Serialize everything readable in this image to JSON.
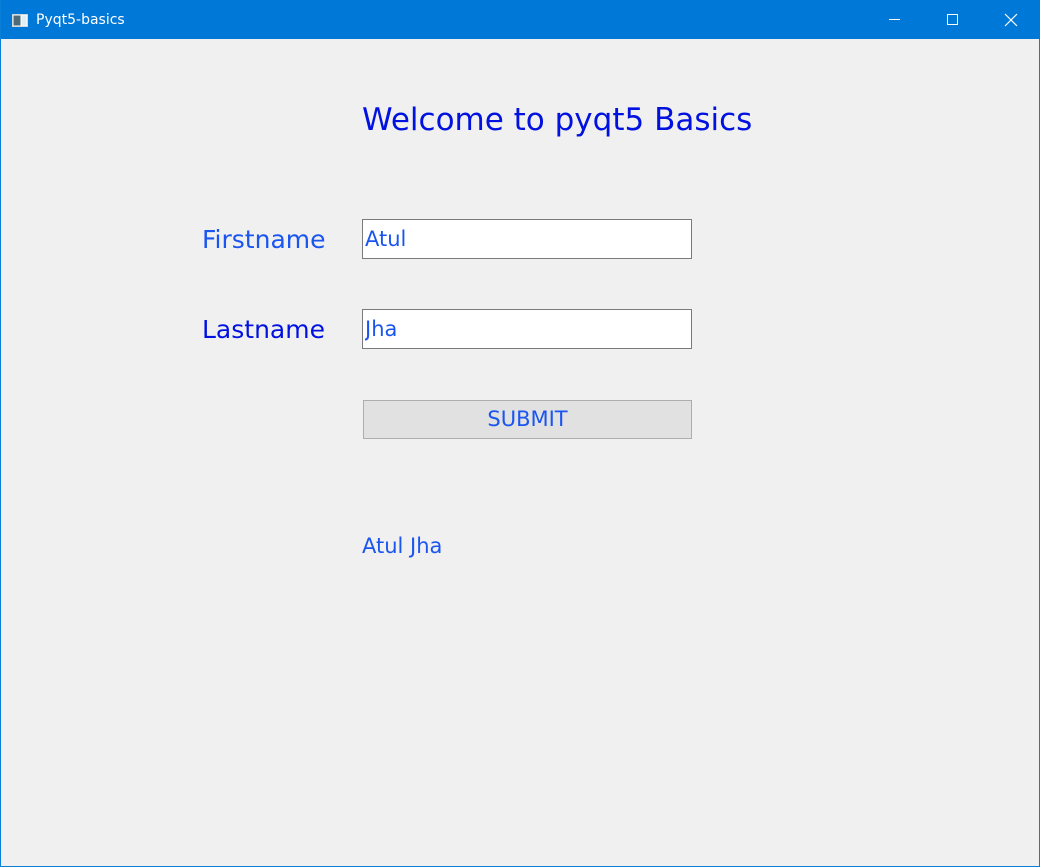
{
  "window": {
    "title": "Pyqt5-basics"
  },
  "form": {
    "heading": "Welcome to pyqt5 Basics",
    "firstname_label": "Firstname",
    "firstname_value": "Atul",
    "lastname_label": "Lastname",
    "lastname_value": "Jha",
    "submit_label": "SUBMIT",
    "result_text": "Atul Jha"
  },
  "icons": {
    "app": "app-window-icon",
    "minimize": "minimize-icon",
    "maximize": "maximize-icon",
    "close": "close-icon"
  },
  "colors": {
    "titlebar": "#0078d7",
    "background": "#f0f0f0",
    "heading": "#0011e0",
    "text_blue": "#1a55f0",
    "button_bg": "#e1e1e1"
  }
}
